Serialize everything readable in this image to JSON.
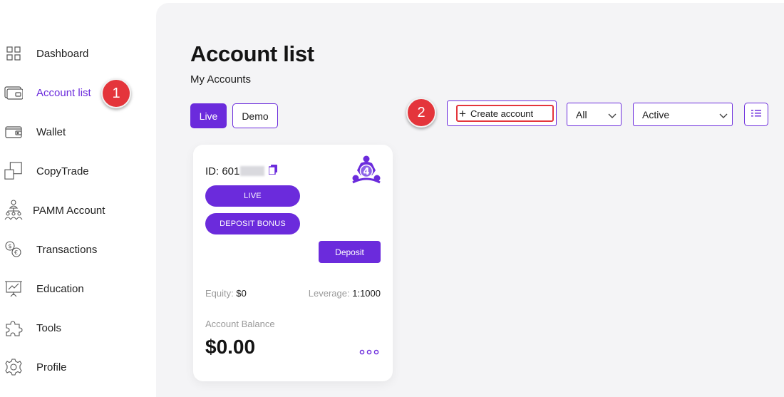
{
  "sidebar": {
    "items": [
      {
        "label": "Dashboard",
        "icon": "dashboard-grid-icon"
      },
      {
        "label": "Account list",
        "icon": "account-card-icon",
        "active": true
      },
      {
        "label": "Wallet",
        "icon": "wallet-icon"
      },
      {
        "label": "CopyTrade",
        "icon": "copy-squares-icon"
      },
      {
        "label": "PAMM Account",
        "icon": "people-hierarchy-icon"
      },
      {
        "label": "Transactions",
        "icon": "currency-exchange-icon"
      },
      {
        "label": "Education",
        "icon": "presentation-chart-icon"
      },
      {
        "label": "Tools",
        "icon": "puzzle-icon"
      },
      {
        "label": "Profile",
        "icon": "gear-icon"
      }
    ]
  },
  "annotations": {
    "step1": "1",
    "step2": "2"
  },
  "main": {
    "title": "Account list",
    "subtitle": "My Accounts",
    "tabs": {
      "live": "Live",
      "demo": "Demo"
    },
    "create_button": "Create account",
    "filter_type": "All",
    "filter_status": "Active"
  },
  "card": {
    "id_prefix": "ID: 601",
    "badge_number": "4",
    "type_pill": "LIVE",
    "bonus_pill": "DEPOSIT BONUS",
    "deposit_label": "Deposit",
    "equity_label": "Equity:",
    "equity_value": "$0",
    "leverage_label": "Leverage:",
    "leverage_value": "1:1000",
    "balance_label": "Account Balance",
    "balance_value": "$0.00"
  },
  "colors": {
    "accent": "#6b2bdc",
    "annotation": "#e4353b",
    "background": "#f4f4f6"
  }
}
